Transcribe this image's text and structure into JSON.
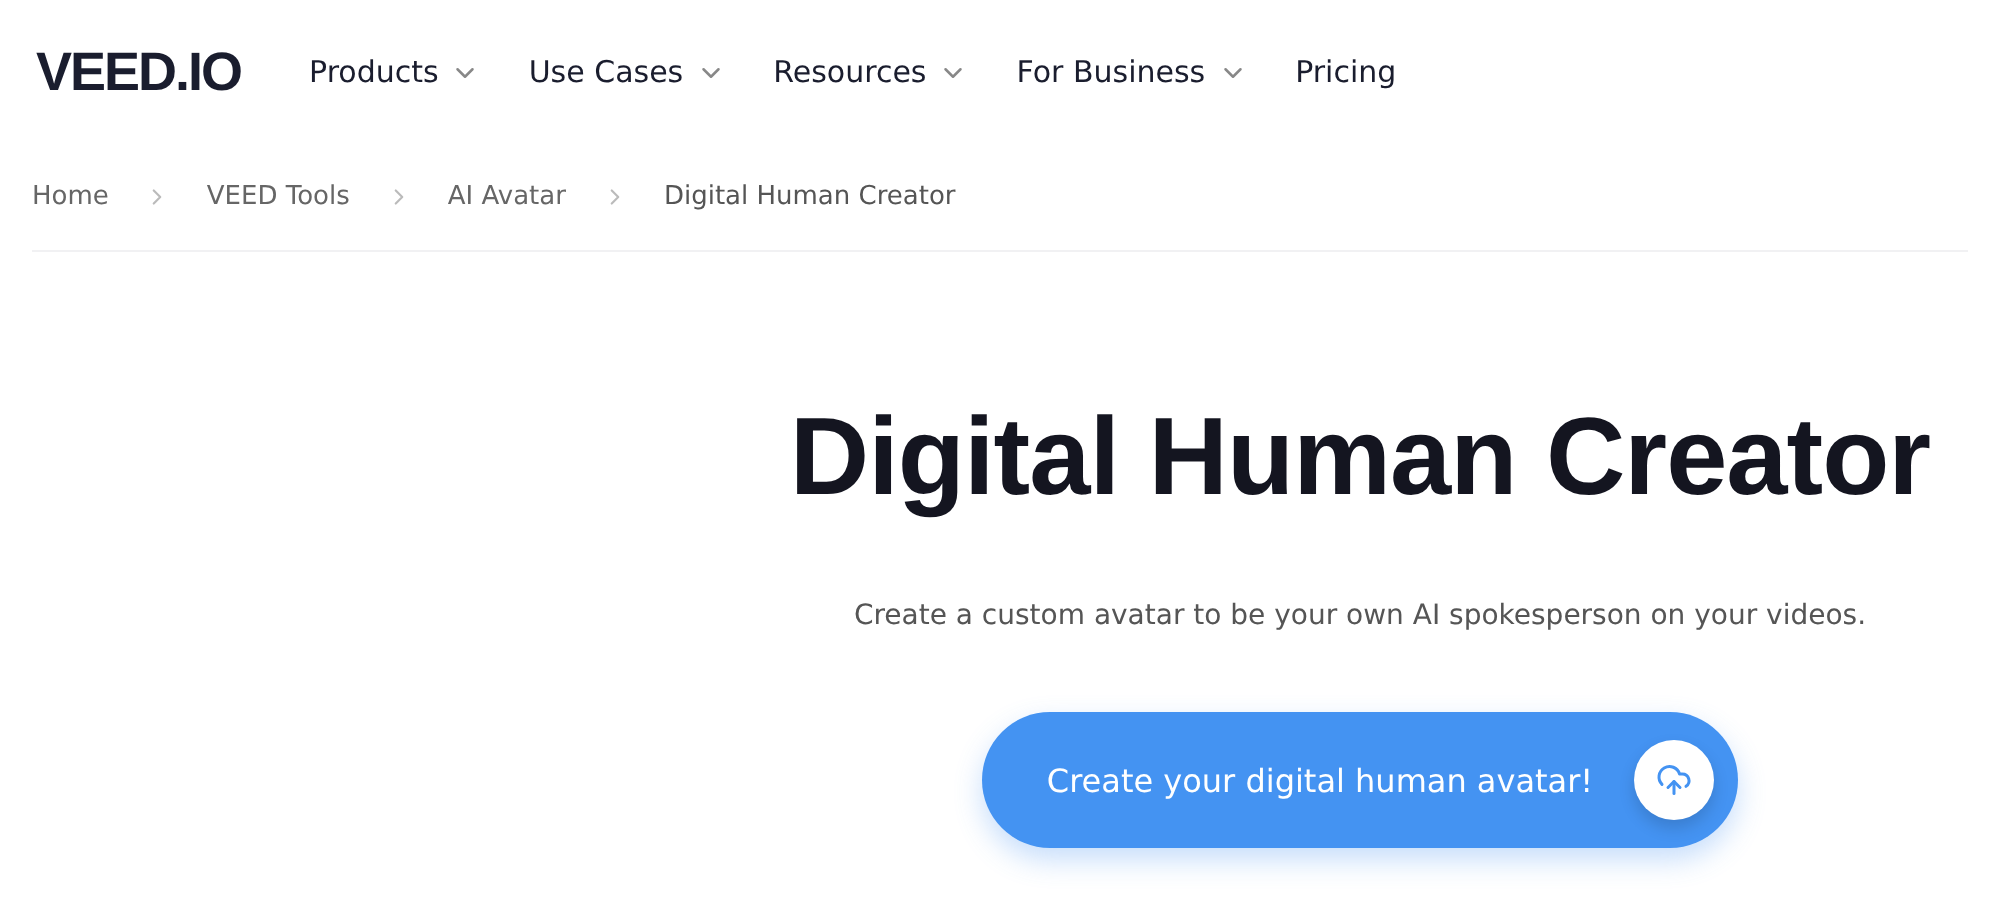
{
  "logo": "VEED.IO",
  "nav": [
    {
      "label": "Products",
      "has_menu": true
    },
    {
      "label": "Use Cases",
      "has_menu": true
    },
    {
      "label": "Resources",
      "has_menu": true
    },
    {
      "label": "For Business",
      "has_menu": true
    },
    {
      "label": "Pricing",
      "has_menu": false
    }
  ],
  "breadcrumb": [
    "Home",
    "VEED Tools",
    "AI Avatar",
    "Digital Human Creator"
  ],
  "hero": {
    "title": "Digital Human Creator",
    "subtitle": "Create a custom avatar to be your own AI spokesperson on your videos.",
    "cta": "Create your digital human avatar!"
  }
}
